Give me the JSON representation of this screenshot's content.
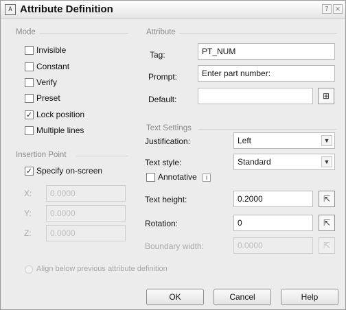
{
  "window": {
    "title": "Attribute Definition",
    "help_btn": "?",
    "close_btn": "×",
    "app_icon": "A"
  },
  "mode": {
    "title": "Mode",
    "options": [
      {
        "label": "Invisible",
        "checked": false
      },
      {
        "label": "Constant",
        "checked": false
      },
      {
        "label": "Verify",
        "checked": false
      },
      {
        "label": "Preset",
        "checked": false
      },
      {
        "label": "Lock position",
        "checked": true
      },
      {
        "label": "Multiple lines",
        "checked": false
      }
    ]
  },
  "insertion": {
    "title": "Insertion Point",
    "specify_label": "Specify on-screen",
    "specify_checked": true,
    "x_label": "X:",
    "x_value": "0.0000",
    "y_label": "Y:",
    "y_value": "0.0000",
    "z_label": "Z:",
    "z_value": "0.0000"
  },
  "attribute": {
    "title": "Attribute",
    "tag_label": "Tag:",
    "tag_value": "PT_NUM",
    "prompt_label": "Prompt:",
    "prompt_value": "Enter part number:",
    "default_label": "Default:",
    "default_value": ""
  },
  "text_settings": {
    "title": "Text Settings",
    "justification_label": "Justification:",
    "justification_value": "Left",
    "style_label": "Text style:",
    "style_value": "Standard",
    "annotative_label": "Annotative",
    "annotative_checked": false,
    "info_icon": "i",
    "height_label": "Text height:",
    "height_value": "0.2000",
    "rotation_label": "Rotation:",
    "rotation_value": "0",
    "boundary_label": "Boundary width:",
    "boundary_value": "0.0000"
  },
  "align_below": {
    "label": "Align below previous attribute definition",
    "checked": false
  },
  "buttons": {
    "ok": "OK",
    "cancel": "Cancel",
    "help": "Help"
  },
  "glyphs": {
    "check": "✓",
    "dropdown": "▼",
    "insert_field": "⊞",
    "pick": "⇱"
  }
}
